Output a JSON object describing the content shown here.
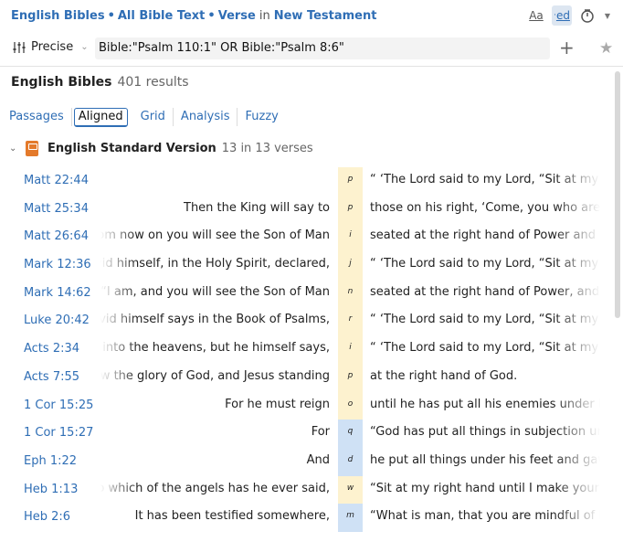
{
  "breadcrumb": {
    "item1": "English Bibles",
    "item2": "All Bible Text",
    "item3": "Verse",
    "in_label": "in",
    "item4": "New Testament"
  },
  "header_icons": {
    "font_size": "Aa",
    "ed": "ed"
  },
  "search": {
    "mode": "Precise",
    "query": "Bible:\"Psalm 110:1\" OR Bible:\"Psalm 8:6\""
  },
  "results": {
    "title": "English Bibles",
    "count": "401 results"
  },
  "tabs": [
    "Passages",
    "Aligned",
    "Grid",
    "Analysis",
    "Fuzzy"
  ],
  "version": {
    "name": "English Standard Version",
    "count": "13 in 13 verses"
  },
  "rows": [
    {
      "ref": "Matt 22:44",
      "left": "",
      "word": "p",
      "right": "“ ‘The Lord said to my Lord, “Sit at my right",
      "hl": "yellow"
    },
    {
      "ref": "Matt 25:34",
      "left": "Then the King will say to",
      "word": "p",
      "right": "those on his right, ‘Come, you who are blessed",
      "hl": "yellow"
    },
    {
      "ref": "Matt 26:64",
      "left": "From now on you will see the Son of Man",
      "word": "i",
      "right": "seated at the right hand of Power and coming",
      "hl": "yellow"
    },
    {
      "ref": "Mark 12:36",
      "left": "David himself, in the Holy Spirit, declared,",
      "word": "j",
      "right": "“ ‘The Lord said to my Lord, “Sit at my right",
      "hl": "yellow"
    },
    {
      "ref": "Mark 14:62",
      "left": "said, “I am, and you will see the Son of Man",
      "word": "n",
      "right": "seated at the right hand of Power, and coming",
      "hl": "yellow"
    },
    {
      "ref": "Luke 20:42",
      "left": "For David himself says in the Book of Psalms,",
      "word": "r",
      "right": "“ ‘The Lord said to my Lord, “Sit at my right",
      "hl": "yellow"
    },
    {
      "ref": "Acts 2:34",
      "left": "For David did not ascend into the heavens, but he himself says,",
      "word": "i",
      "right": "“ ‘The Lord said to my Lord, “Sit at my right",
      "hl": "yellow"
    },
    {
      "ref": "Acts 7:55",
      "left": "saw the glory of God, and Jesus standing",
      "word": "p",
      "right": "at the right hand of God.",
      "hl": "yellow"
    },
    {
      "ref": "1 Cor 15:25",
      "left": "For he must reign",
      "word": "o",
      "right": "until he has put all his enemies under his feet.",
      "hl": "yellow"
    },
    {
      "ref": "1 Cor 15:27",
      "left": "For",
      "word": "q",
      "right": "“God has put all things in subjection under",
      "hl": "blue"
    },
    {
      "ref": "Eph 1:22",
      "left": "And",
      "word": "d",
      "right": "he put all things under his feet and gave him",
      "hl": "blue"
    },
    {
      "ref": "Heb 1:13",
      "left": "And to which of the angels has he ever said,",
      "word": "w",
      "right": "“Sit at my right hand until I make your enemies",
      "hl": "yellow"
    },
    {
      "ref": "Heb 2:6",
      "left": "It has been testified somewhere,",
      "word": "m",
      "right": "“What is man, that you are mindful of him,",
      "hl": "blue"
    }
  ]
}
